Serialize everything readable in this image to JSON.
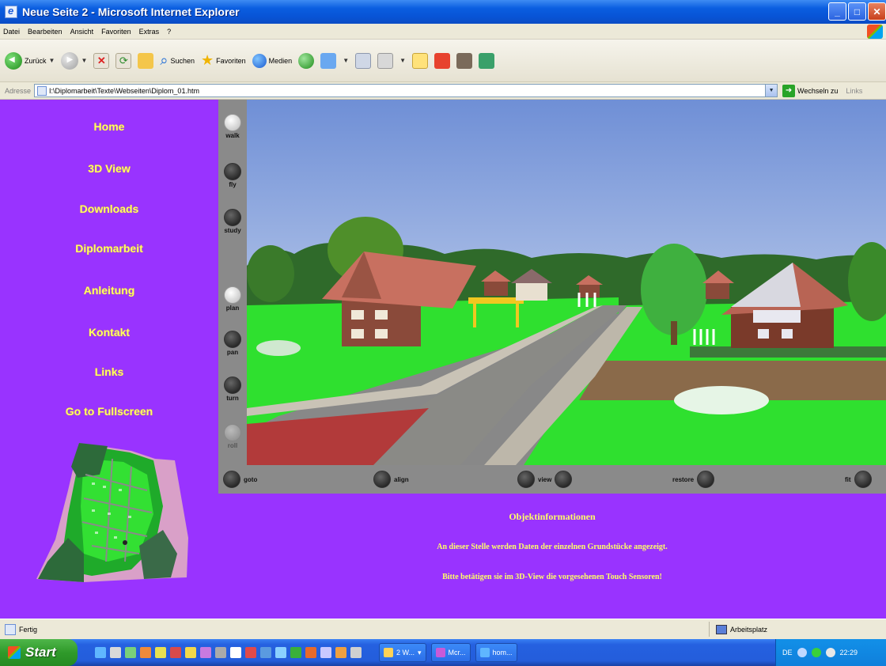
{
  "window": {
    "title": "Neue Seite 2 - Microsoft Internet Explorer",
    "minimize": "_",
    "maximize": "□",
    "close": "✕"
  },
  "menu": [
    "Datei",
    "Bearbeiten",
    "Ansicht",
    "Favoriten",
    "Extras",
    "?"
  ],
  "toolbar": {
    "back_label": "Zurück",
    "search_label": "Suchen",
    "favorites_label": "Favoriten",
    "media_label": "Medien"
  },
  "address": {
    "label": "Adresse",
    "url": "I:\\Diplomarbeit\\Texte\\Webseiten\\Diplom_01.htm",
    "go_label": "Wechseln zu",
    "links_label": "Links"
  },
  "nav": [
    "Home",
    "3D View",
    "Downloads",
    "Diplomarbeit",
    "Anleitung",
    "Kontakt",
    "Links",
    "Go to Fullscreen"
  ],
  "viewer": {
    "left_controls": [
      {
        "label": "walk",
        "state": "off"
      },
      {
        "label": "fly",
        "state": "on"
      },
      {
        "label": "study",
        "state": "on"
      },
      {
        "label": "plan",
        "state": "off"
      },
      {
        "label": "pan",
        "state": "on"
      },
      {
        "label": "turn",
        "state": "on"
      },
      {
        "label": "roll",
        "state": "dim"
      }
    ],
    "bottom_controls": {
      "goto": "goto",
      "align": "align",
      "view": "view",
      "restore": "restore",
      "fit": "fit"
    }
  },
  "info": {
    "title": "Objektinformationen",
    "line1": "An dieser Stelle werden Daten der einzelnen Grundstücke angezeigt.",
    "line2": "Bitte betätigen sie im 3D-View die vorgesehenen Touch Sensoren!"
  },
  "status": {
    "text": "Fertig",
    "zone": "Arbeitsplatz"
  },
  "taskbar": {
    "start_label": "Start",
    "tasks": [
      "2 W...",
      "Mcr...",
      "hom..."
    ],
    "language": "DE",
    "clock": "22:29"
  },
  "colors": {
    "page_background": "#9933ff",
    "nav_text": "#ffff66",
    "viewer_frame": "#8a8a8a"
  }
}
